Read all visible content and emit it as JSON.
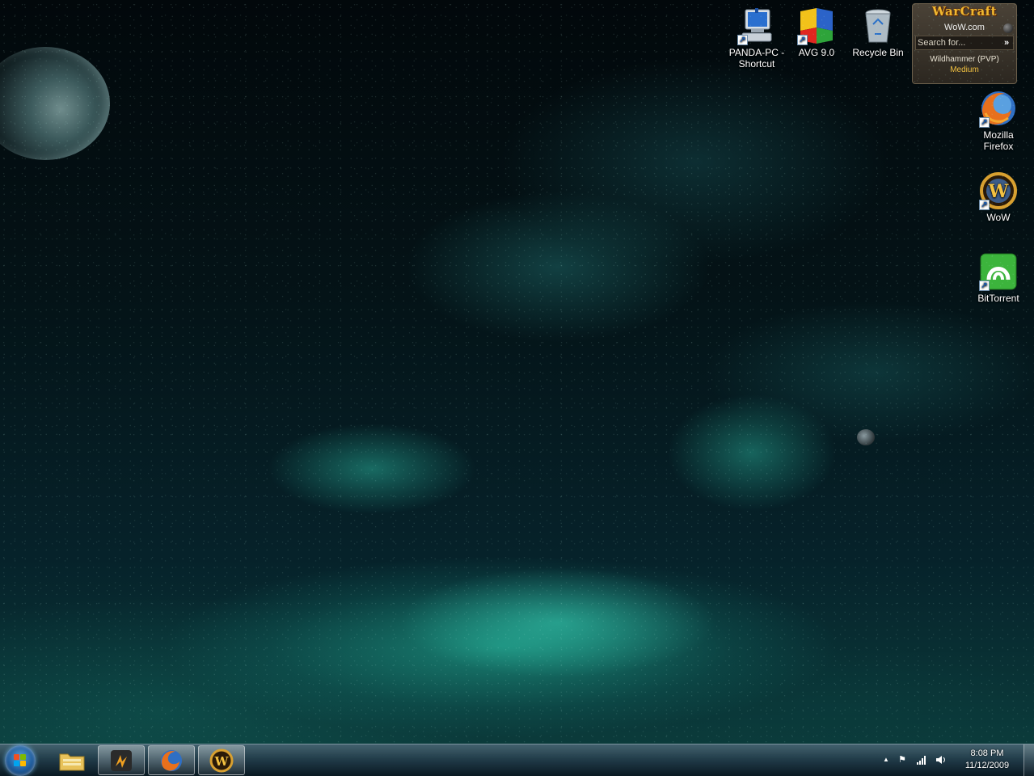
{
  "desktop_icons": {
    "panda_pc": "PANDA-PC - Shortcut",
    "avg": "AVG 9.0",
    "recycle_bin": "Recycle Bin",
    "firefox": "Mozilla Firefox",
    "wow": "WoW",
    "bittorrent": "BitTorrent"
  },
  "gadget": {
    "logo": "WarCraft",
    "site": "WoW.com",
    "search_placeholder": "Search for...",
    "go": "»",
    "realm": "Wildhammer (PVP)",
    "population": "Medium"
  },
  "tray": {
    "time": "8:08 PM",
    "date": "11/12/2009",
    "chevron": "▲",
    "flag": "⚑",
    "volume": "🔊"
  }
}
